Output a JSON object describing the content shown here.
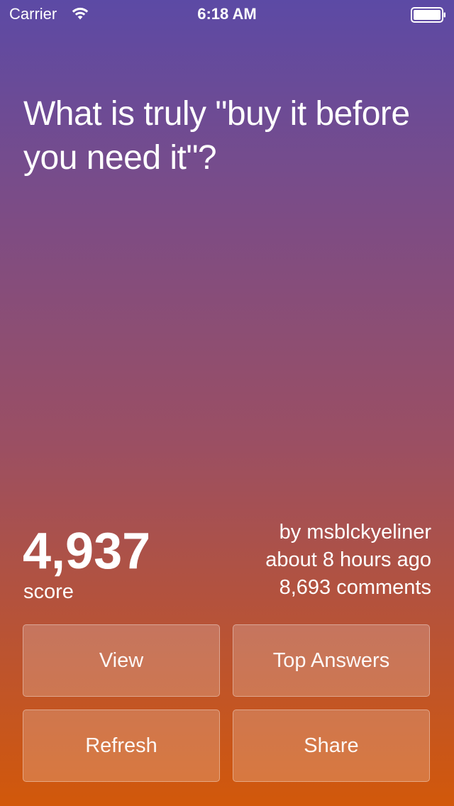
{
  "status_bar": {
    "carrier": "Carrier",
    "time": "6:18 AM",
    "wifi_icon": "wifi-icon",
    "battery_icon": "battery-icon"
  },
  "post": {
    "title": "What is truly \"buy it before you need it\"?",
    "score": "4,937",
    "score_label": "score",
    "author": "by msblckyeliner",
    "age": "about 8 hours ago",
    "comments": "8,693 comments"
  },
  "actions": {
    "view": "View",
    "top_answers": "Top Answers",
    "refresh": "Refresh",
    "share": "Share"
  },
  "colors": {
    "gradient_top": "#5c4aa5",
    "gradient_bottom": "#d2580a",
    "text": "#ffffff"
  }
}
